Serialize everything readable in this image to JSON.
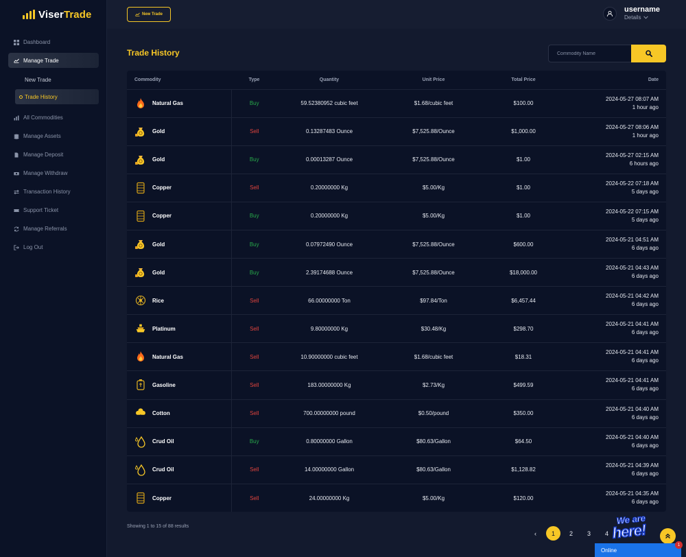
{
  "brand": {
    "name_part1": "Viser",
    "name_part2": "Trade",
    "accent": "#f7c726"
  },
  "sidebar": {
    "items": [
      {
        "label": "Dashboard",
        "icon": "dashboard-icon"
      },
      {
        "label": "Manage Trade",
        "icon": "chart-line-icon"
      },
      {
        "label": "All Commodities",
        "icon": "chart-icon"
      },
      {
        "label": "Manage Assets",
        "icon": "coins-icon"
      },
      {
        "label": "Manage Deposit",
        "icon": "file-icon"
      },
      {
        "label": "Manage Withdraw",
        "icon": "money-icon"
      },
      {
        "label": "Transaction History",
        "icon": "exchange-icon"
      },
      {
        "label": "Support Ticket",
        "icon": "ticket-icon"
      },
      {
        "label": "Manage Referrals",
        "icon": "referral-icon"
      },
      {
        "label": "Log Out",
        "icon": "logout-icon"
      }
    ],
    "sub_items": [
      {
        "label": "New Trade"
      },
      {
        "label": "Trade History"
      }
    ]
  },
  "header": {
    "new_trade_label": "New Trade",
    "username": "username",
    "details_label": "Details"
  },
  "main": {
    "title": "Trade History",
    "search_placeholder": "Commodity Name",
    "columns": [
      "Commodity",
      "Type",
      "Quantity",
      "Unit Price",
      "Total Price",
      "Date"
    ],
    "rows": [
      {
        "commodity": "Natural Gas",
        "icon": "fire-icon",
        "type": "Buy",
        "quantity": "59.52380952 cubic feet",
        "unit_price": "$1.68/cubic feet",
        "total": "$100.00",
        "date": "2024-05-27 08:07 AM",
        "ago": "1 hour ago"
      },
      {
        "commodity": "Gold",
        "icon": "gold-bag-icon",
        "type": "Sell",
        "quantity": "0.13287483 Ounce",
        "unit_price": "$7,525.88/Ounce",
        "total": "$1,000.00",
        "date": "2024-05-27 08:06 AM",
        "ago": "1 hour ago"
      },
      {
        "commodity": "Gold",
        "icon": "gold-bag-icon",
        "type": "Buy",
        "quantity": "0.00013287 Ounce",
        "unit_price": "$7,525.88/Ounce",
        "total": "$1.00",
        "date": "2024-05-27 02:15 AM",
        "ago": "6 hours ago"
      },
      {
        "commodity": "Copper",
        "icon": "copper-icon",
        "type": "Sell",
        "quantity": "0.20000000 Kg",
        "unit_price": "$5.00/Kg",
        "total": "$1.00",
        "date": "2024-05-22 07:18 AM",
        "ago": "5 days ago"
      },
      {
        "commodity": "Copper",
        "icon": "copper-icon",
        "type": "Buy",
        "quantity": "0.20000000 Kg",
        "unit_price": "$5.00/Kg",
        "total": "$1.00",
        "date": "2024-05-22 07:15 AM",
        "ago": "5 days ago"
      },
      {
        "commodity": "Gold",
        "icon": "gold-bag-icon",
        "type": "Buy",
        "quantity": "0.07972490 Ounce",
        "unit_price": "$7,525.88/Ounce",
        "total": "$600.00",
        "date": "2024-05-21 04:51 AM",
        "ago": "6 days ago"
      },
      {
        "commodity": "Gold",
        "icon": "gold-bag-icon",
        "type": "Buy",
        "quantity": "2.39174688 Ounce",
        "unit_price": "$7,525.88/Ounce",
        "total": "$18,000.00",
        "date": "2024-05-21 04:43 AM",
        "ago": "6 days ago"
      },
      {
        "commodity": "Rice",
        "icon": "rice-icon",
        "type": "Sell",
        "quantity": "66.00000000 Ton",
        "unit_price": "$97.84/Ton",
        "total": "$6,457.44",
        "date": "2024-05-21 04:42 AM",
        "ago": "6 days ago"
      },
      {
        "commodity": "Platinum",
        "icon": "platinum-icon",
        "type": "Sell",
        "quantity": "9.80000000 Kg",
        "unit_price": "$30.48/Kg",
        "total": "$298.70",
        "date": "2024-05-21 04:41 AM",
        "ago": "6 days ago"
      },
      {
        "commodity": "Natural Gas",
        "icon": "fire-icon",
        "type": "Sell",
        "quantity": "10.90000000 cubic feet",
        "unit_price": "$1.68/cubic feet",
        "total": "$18.31",
        "date": "2024-05-21 04:41 AM",
        "ago": "6 days ago"
      },
      {
        "commodity": "Gasoline",
        "icon": "gasoline-icon",
        "type": "Sell",
        "quantity": "183.00000000 Kg",
        "unit_price": "$2.73/Kg",
        "total": "$499.59",
        "date": "2024-05-21 04:41 AM",
        "ago": "6 days ago"
      },
      {
        "commodity": "Cotton",
        "icon": "cotton-icon",
        "type": "Sell",
        "quantity": "700.00000000 pound",
        "unit_price": "$0.50/pound",
        "total": "$350.00",
        "date": "2024-05-21 04:40 AM",
        "ago": "6 days ago"
      },
      {
        "commodity": "Crud Oil",
        "icon": "oil-drop-icon",
        "type": "Buy",
        "quantity": "0.80000000 Gallon",
        "unit_price": "$80.63/Gallon",
        "total": "$64.50",
        "date": "2024-05-21 04:40 AM",
        "ago": "6 days ago"
      },
      {
        "commodity": "Crud Oil",
        "icon": "oil-drop-icon",
        "type": "Sell",
        "quantity": "14.00000000 Gallon",
        "unit_price": "$80.63/Gallon",
        "total": "$1,128.82",
        "date": "2024-05-21 04:39 AM",
        "ago": "6 days ago"
      },
      {
        "commodity": "Copper",
        "icon": "copper-icon",
        "type": "Sell",
        "quantity": "24.00000000 Kg",
        "unit_price": "$5.00/Kg",
        "total": "$120.00",
        "date": "2024-05-21 04:35 AM",
        "ago": "6 days ago"
      }
    ],
    "showing": "Showing 1 to 15 of 88 results",
    "pagination": {
      "prev": "‹",
      "pages": [
        "1",
        "2",
        "3",
        "4"
      ],
      "active": "1"
    }
  },
  "widgets": {
    "chat_banner_line1": "We are",
    "chat_banner_line2": "here!",
    "online_label": "Online",
    "badge_count": "1"
  },
  "colors": {
    "buy": "#27a84a",
    "sell": "#e0443e",
    "accent": "#f7c726"
  }
}
